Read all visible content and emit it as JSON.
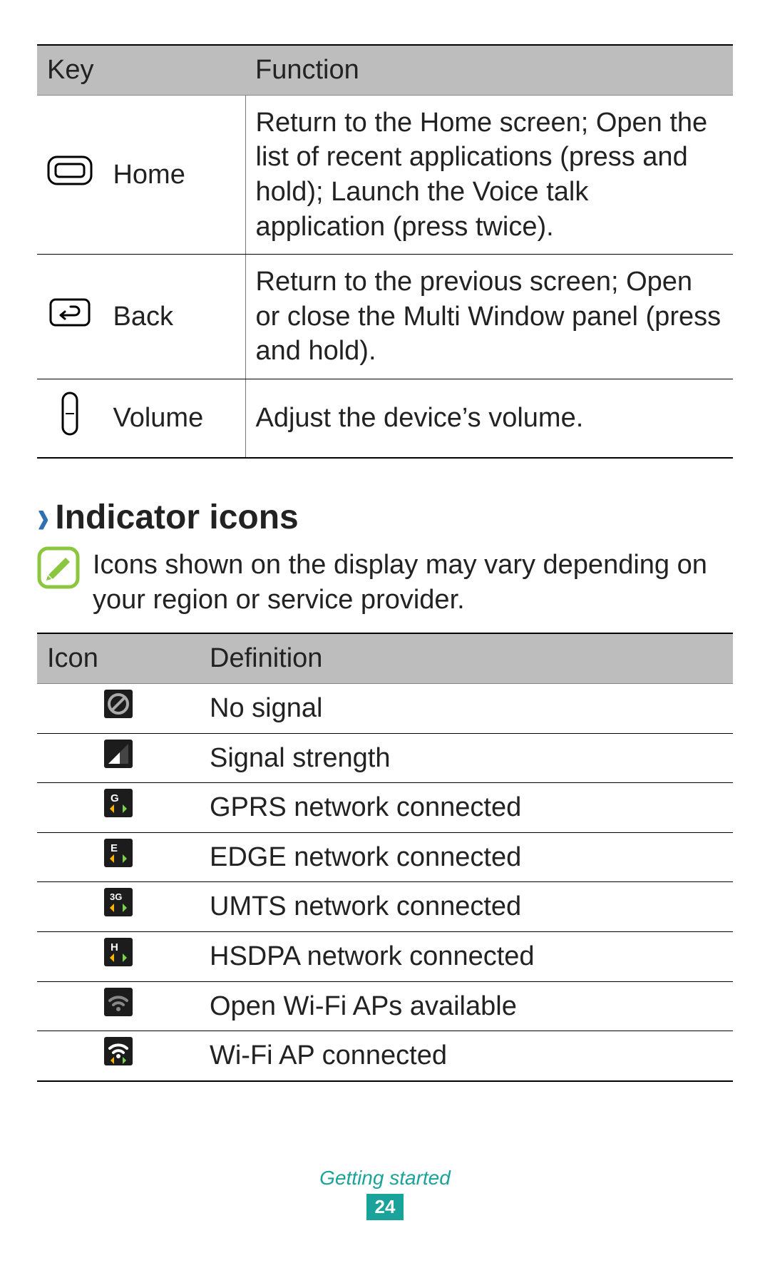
{
  "keys_table": {
    "headers": {
      "key": "Key",
      "function": "Function"
    },
    "rows": [
      {
        "name": "Home",
        "function": "Return to the Home screen; Open the list of recent applications (press and hold); Launch the Voice talk application (press twice)."
      },
      {
        "name": "Back",
        "function": "Return to the previous screen; Open or close the Multi Window panel (press and hold)."
      },
      {
        "name": "Volume",
        "function": "Adjust the device’s volume."
      }
    ]
  },
  "indicator_section": {
    "title": "Indicator icons",
    "note": "Icons shown on the display may vary depending on your region or service provider."
  },
  "icons_table": {
    "headers": {
      "icon": "Icon",
      "definition": "Definition"
    },
    "rows": [
      {
        "definition": "No signal"
      },
      {
        "definition": "Signal strength"
      },
      {
        "definition": "GPRS network connected"
      },
      {
        "definition": "EDGE network connected"
      },
      {
        "definition": "UMTS network connected"
      },
      {
        "definition": "HSDPA network connected"
      },
      {
        "definition": "Open Wi-Fi APs available"
      },
      {
        "definition": "Wi-Fi AP connected"
      }
    ]
  },
  "footer": {
    "section": "Getting started",
    "page": "24"
  }
}
